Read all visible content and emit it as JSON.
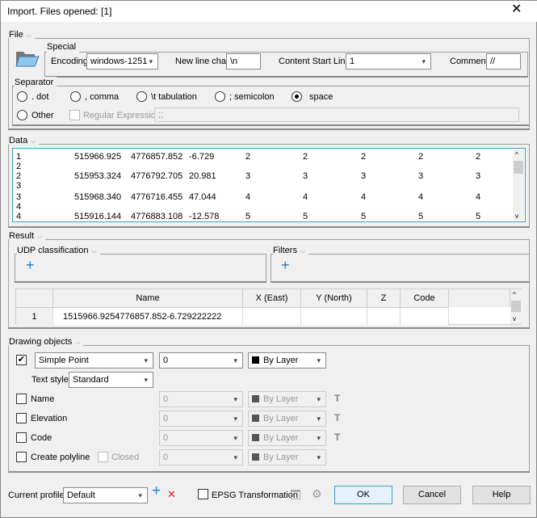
{
  "window": {
    "title": "Import. Files opened: [1]",
    "close_icon": "close-icon"
  },
  "file": {
    "label": "File",
    "special_label": "Special",
    "encoding_label": "Encoding",
    "encoding_value": "windows-1251",
    "newline_label": "New line char",
    "newline_value": "\\n",
    "content_start_label": "Content Start Line",
    "content_start_value": "1",
    "comment_label": "Comment",
    "comment_value": "//"
  },
  "separator": {
    "label": "Separator",
    "options": [
      ".  dot",
      ", comma",
      "\\t tabulation",
      "; semicolon",
      "space"
    ],
    "selected": "space",
    "other_label": "Other",
    "regex_label": "Regular Expression",
    "regex_value": ";;"
  },
  "data": {
    "label": "Data",
    "rows": [
      [
        "1",
        "515966.925",
        "4776857.852",
        "-6.729",
        "2",
        "2",
        "2",
        "2",
        "2"
      ],
      [
        "2"
      ],
      [
        "2",
        "515953.324",
        "4776792.705",
        "20.981",
        "3",
        "3",
        "3",
        "3",
        "3"
      ],
      [
        "3"
      ],
      [
        "3",
        "515968.340",
        "4776716.455",
        "47.044",
        "4",
        "4",
        "4",
        "4",
        "4"
      ],
      [
        "4"
      ],
      [
        "4",
        "515916.144",
        "4776883.108",
        "-12.578",
        "5",
        "5",
        "5",
        "5",
        "5"
      ]
    ]
  },
  "result": {
    "label": "Result",
    "udp_label": "UDP classification",
    "filters_label": "Filters",
    "table": {
      "headers": [
        "Name",
        "X (East)",
        "Y (North)",
        "Z",
        "Code"
      ],
      "rows": [
        {
          "num": "1",
          "name": "1515966.9254776857.852-6.729222222",
          "x": "",
          "y": "",
          "z": "",
          "code": ""
        }
      ]
    }
  },
  "drawing": {
    "label": "Drawing objects",
    "point_type": "Simple Point",
    "point_layer": "0",
    "point_color": "By Layer",
    "point_checked": true,
    "text_style_label": "Text style",
    "text_style": "Standard",
    "rows": [
      {
        "label": "Name",
        "layer": "0",
        "color": "By Layer"
      },
      {
        "label": "Elevation",
        "layer": "0",
        "color": "By Layer"
      },
      {
        "label": "Code",
        "layer": "0",
        "color": "By Layer"
      },
      {
        "label": "Create polyline",
        "layer": "0",
        "color": "By Layer"
      }
    ],
    "closed_label": "Closed"
  },
  "footer": {
    "profile_label": "Current profile:",
    "profile_value": "Default",
    "epsg_label": "EPSG Transformation",
    "ok": "OK",
    "cancel": "Cancel",
    "help": "Help"
  },
  "colors": {
    "accent": "#1e7fd0",
    "delete": "#e02020",
    "focus": "#3aa0c8"
  }
}
